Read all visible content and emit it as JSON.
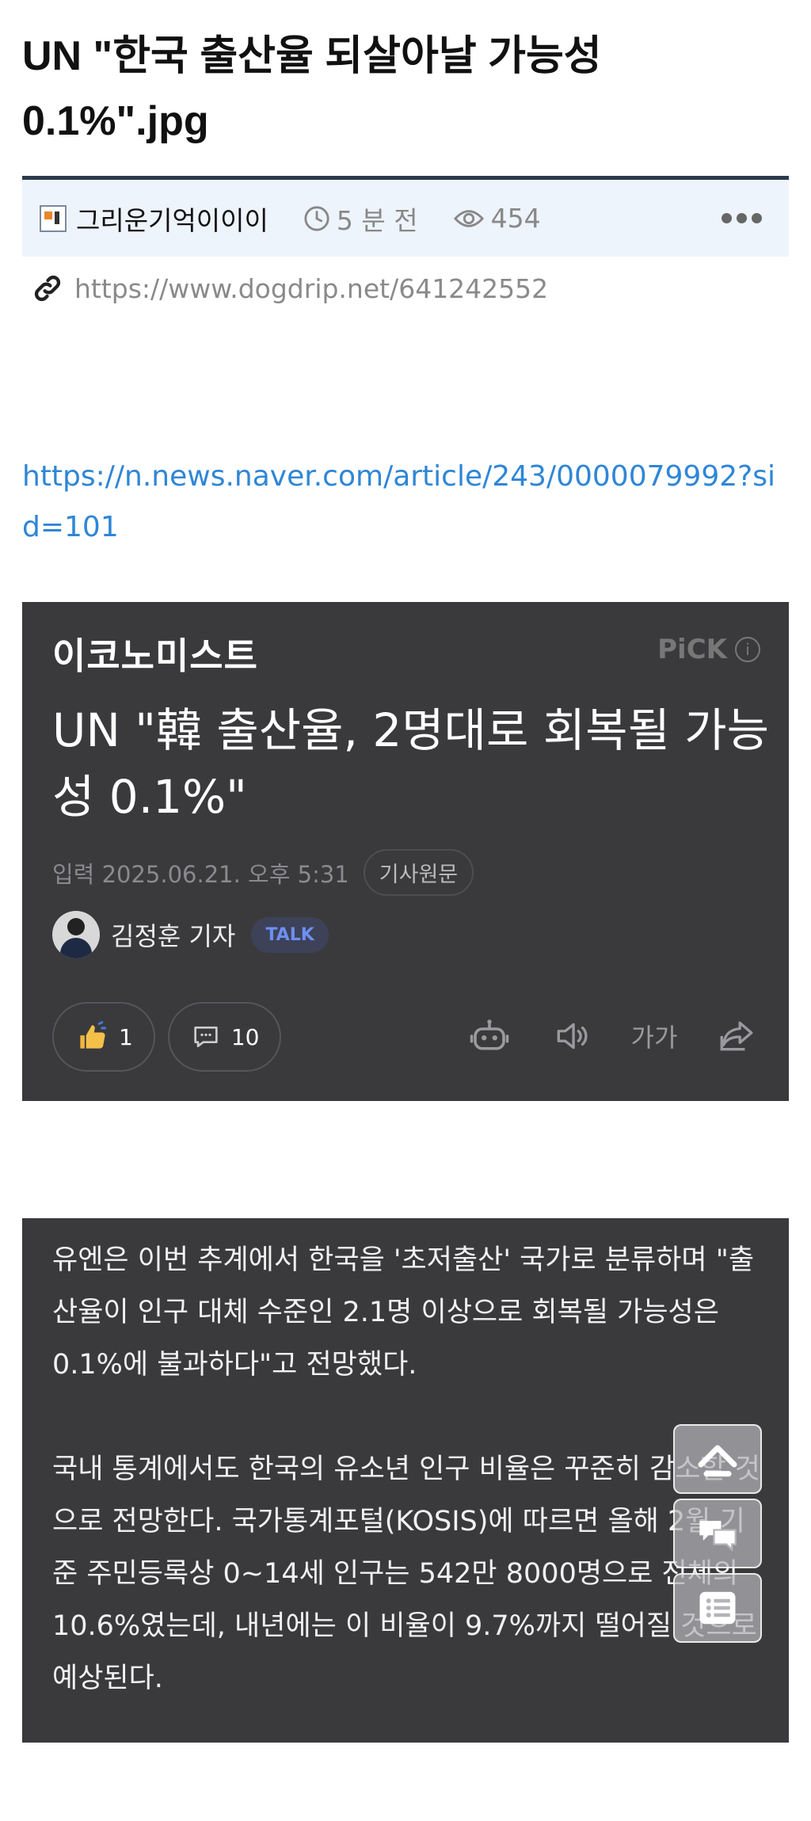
{
  "post": {
    "title": "UN \"한국 출산율 되살아날 가능성 0.1%\".jpg",
    "author": "그리운기억이이이",
    "time": "5 분 전",
    "views": "454",
    "url": "https://www.dogdrip.net/641242552"
  },
  "content": {
    "link": "https://n.news.naver.com/article/243/0000079992?sid=101"
  },
  "news_card": {
    "brand": "이코노미스트",
    "pick": "PiCK",
    "headline": "UN \"韓 출산율, 2명대로 회복될 가능성 0.1%\"",
    "date": "입력 2025.06.21. 오후 5:31",
    "original_button": "기사원문",
    "reporter": "김정훈 기자",
    "talk": "TALK",
    "likes": "1",
    "comments": "10",
    "font_size_label": "가가"
  },
  "article_body": {
    "paragraph1": "유엔은 이번 추계에서 한국을 '초저출산' 국가로 분류하며 \"출산율이 인구 대체 수준인 2.1명 이상으로 회복될 가능성은 0.1%에 불과하다\"고 전망했다.",
    "paragraph2": "국내 통계에서도 한국의 유소년 인구 비율은 꾸준히 감소할 것으로 전망한다. 국가통계포털(KOSIS)에 따르면 올해 2월 기준 주민등록상 0~14세 인구는 542만 8000명으로 전체의 10.6%였는데, 내년에는 이 비율이 9.7%까지 떨어질 것으로 예상된다."
  },
  "colors": {
    "card_bg": "#3a3a3d",
    "link": "#2f86d6",
    "meta_bg": "#eef4fc",
    "talk_text": "#6d8ff0"
  },
  "icons": [
    "clock-icon",
    "eye-icon",
    "more-icon",
    "link-icon",
    "info-icon",
    "thumbs-up-icon",
    "comment-icon",
    "robot-icon",
    "speaker-icon",
    "share-icon",
    "scroll-top-icon",
    "chat-icon",
    "list-icon"
  ]
}
